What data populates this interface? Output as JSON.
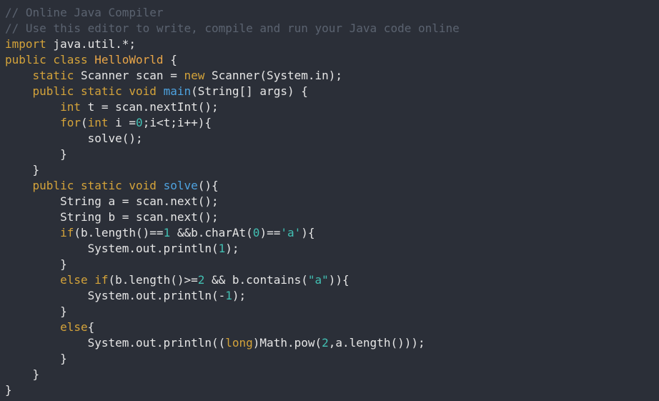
{
  "editor": {
    "colors": {
      "background": "#2b2f38",
      "comment": "#5b6370",
      "keyword": "#d4a33a",
      "name": "#e6e6e6",
      "class": "#e8a548",
      "func": "#4ea3e0",
      "number": "#42c0b3",
      "string": "#42c0b3"
    },
    "lines": [
      [
        [
          "comment",
          "// Online Java Compiler"
        ]
      ],
      [
        [
          "comment",
          "// Use this editor to write, compile and run your Java code online"
        ]
      ],
      [
        [
          "keyword",
          "import"
        ],
        [
          "name",
          " java.util.*;"
        ]
      ],
      [
        [
          "keyword",
          "public class "
        ],
        [
          "class",
          "HelloWorld"
        ],
        [
          "name",
          " {"
        ]
      ],
      [
        [
          "name",
          "    "
        ],
        [
          "keyword",
          "static"
        ],
        [
          "name",
          " Scanner scan = "
        ],
        [
          "keyword",
          "new"
        ],
        [
          "name",
          " Scanner(System.in);"
        ]
      ],
      [
        [
          "name",
          "    "
        ],
        [
          "keyword",
          "public static void "
        ],
        [
          "func",
          "main"
        ],
        [
          "name",
          "(String[] args) {"
        ]
      ],
      [
        [
          "name",
          "        "
        ],
        [
          "keyword",
          "int"
        ],
        [
          "name",
          " t = scan.nextInt();"
        ]
      ],
      [
        [
          "name",
          "        "
        ],
        [
          "keyword",
          "for"
        ],
        [
          "name",
          "("
        ],
        [
          "keyword",
          "int"
        ],
        [
          "name",
          " i ="
        ],
        [
          "number",
          "0"
        ],
        [
          "name",
          ";i<t;i++){"
        ]
      ],
      [
        [
          "name",
          "            solve();"
        ]
      ],
      [
        [
          "name",
          "        }"
        ]
      ],
      [
        [
          "name",
          "    }"
        ]
      ],
      [
        [
          "name",
          "    "
        ],
        [
          "keyword",
          "public static void "
        ],
        [
          "func",
          "solve"
        ],
        [
          "name",
          "(){"
        ]
      ],
      [
        [
          "name",
          "        String a = scan.next();"
        ]
      ],
      [
        [
          "name",
          "        String b = scan.next();"
        ]
      ],
      [
        [
          "name",
          "        "
        ],
        [
          "keyword",
          "if"
        ],
        [
          "name",
          "(b.length()=="
        ],
        [
          "number",
          "1"
        ],
        [
          "name",
          " &&b.charAt("
        ],
        [
          "number",
          "0"
        ],
        [
          "name",
          ")=="
        ],
        [
          "string",
          "'a'"
        ],
        [
          "name",
          "){"
        ]
      ],
      [
        [
          "name",
          "            System.out.println("
        ],
        [
          "number",
          "1"
        ],
        [
          "name",
          ");"
        ]
      ],
      [
        [
          "name",
          "        }"
        ]
      ],
      [
        [
          "name",
          "        "
        ],
        [
          "keyword",
          "else if"
        ],
        [
          "name",
          "(b.length()>="
        ],
        [
          "number",
          "2"
        ],
        [
          "name",
          " && b.contains("
        ],
        [
          "string",
          "\"a\""
        ],
        [
          "name",
          ")){"
        ]
      ],
      [
        [
          "name",
          "            System.out.println(-"
        ],
        [
          "number",
          "1"
        ],
        [
          "name",
          ");"
        ]
      ],
      [
        [
          "name",
          "        }"
        ]
      ],
      [
        [
          "name",
          "        "
        ],
        [
          "keyword",
          "else"
        ],
        [
          "name",
          "{"
        ]
      ],
      [
        [
          "name",
          "            System.out.println(("
        ],
        [
          "keyword",
          "long"
        ],
        [
          "name",
          ")Math.pow("
        ],
        [
          "number",
          "2"
        ],
        [
          "name",
          ",a.length()));"
        ]
      ],
      [
        [
          "name",
          "        }"
        ]
      ],
      [
        [
          "name",
          "    }"
        ]
      ],
      [
        [
          "name",
          "}"
        ]
      ]
    ]
  }
}
